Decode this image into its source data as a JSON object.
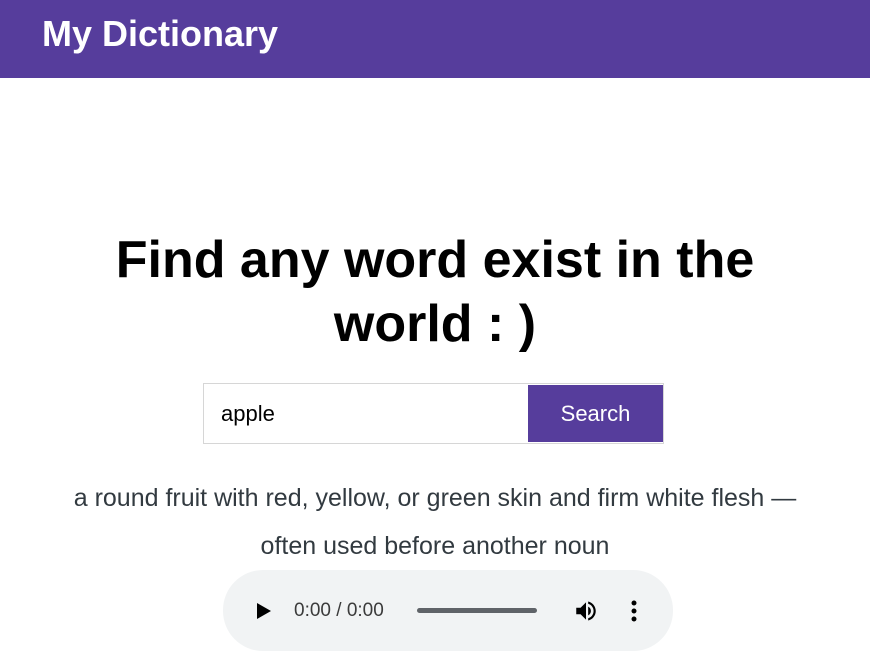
{
  "header": {
    "brand": "My Dictionary"
  },
  "hero": {
    "headline": "Find any word exist in the world : )"
  },
  "search": {
    "value": "apple",
    "placeholder": "",
    "button_label": "Search"
  },
  "result": {
    "definition_line1": "a round fruit with red, yellow, or green skin and firm white flesh —",
    "definition_line2": "often used before another noun"
  },
  "audio": {
    "time_display": "0:00 / 0:00",
    "play_icon": "play-icon",
    "volume_icon": "volume-icon",
    "menu_icon": "more-vert-icon"
  },
  "colors": {
    "brand": "#563d9c",
    "player_bg": "#f1f3f4",
    "text_definition": "#323a40"
  }
}
